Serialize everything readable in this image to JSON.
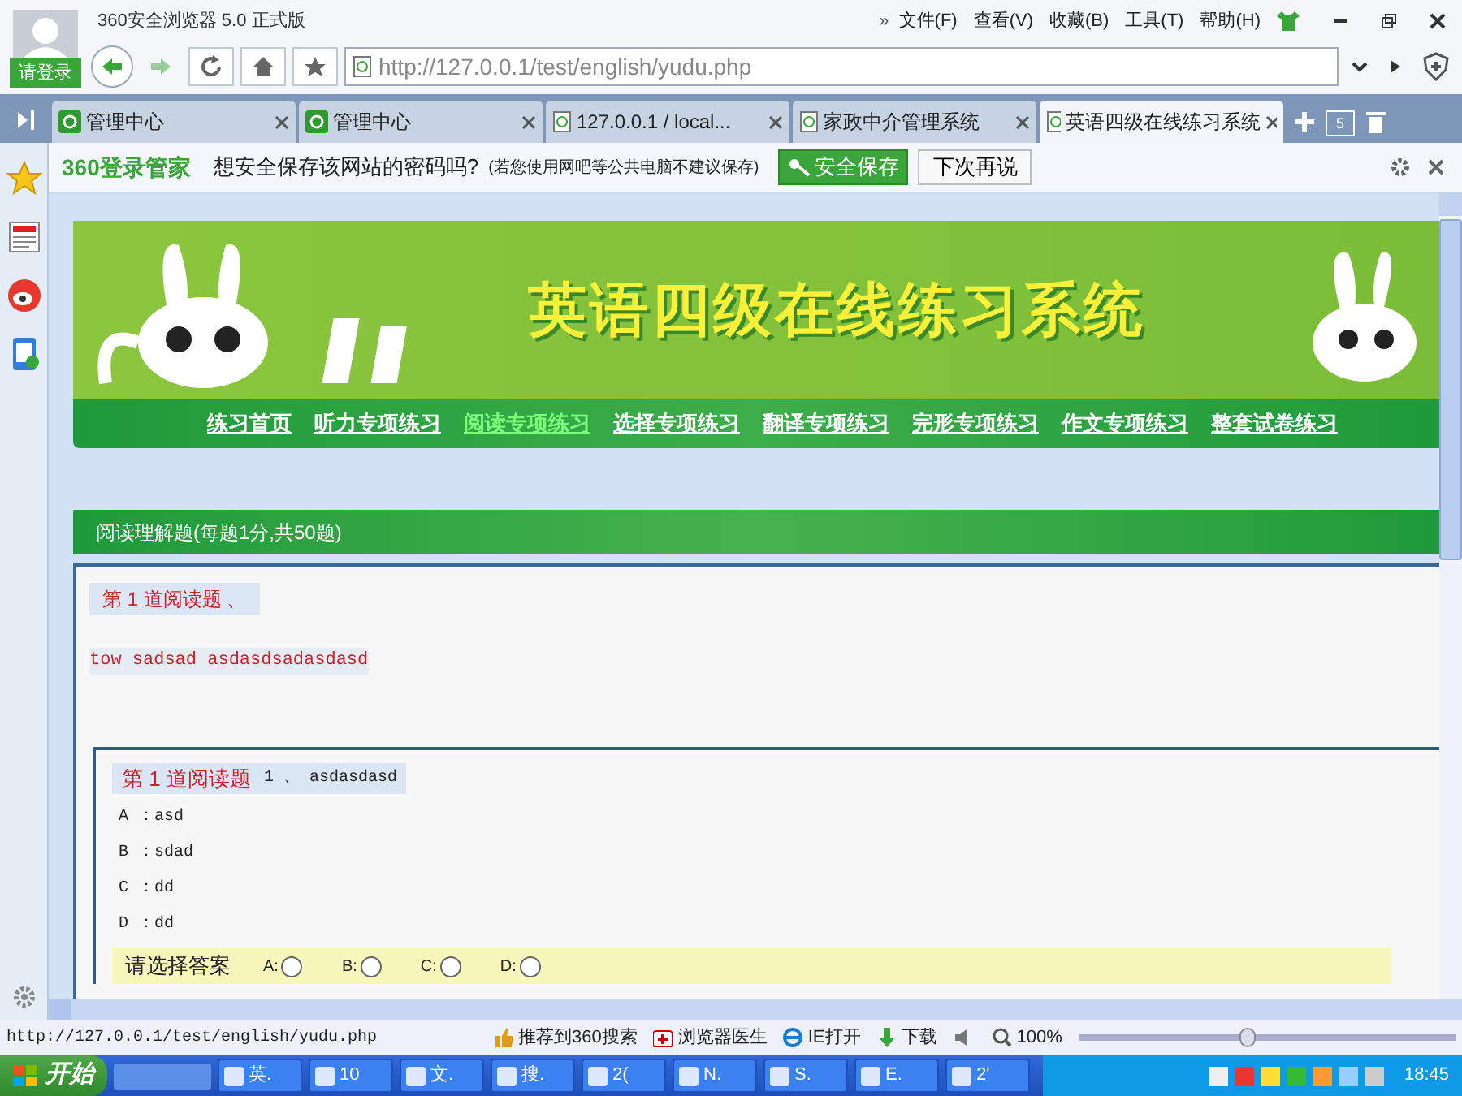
{
  "window": {
    "title": "360安全浏览器 5.0 正式版",
    "login": "请登录",
    "more": "»",
    "menu": [
      "文件(F)",
      "查看(V)",
      "收藏(B)",
      "工具(T)",
      "帮助(H)"
    ]
  },
  "address_bar": {
    "url": "http://127.0.0.1/test/english/yudu.php"
  },
  "tabs": [
    {
      "label": "管理中心",
      "kind": "logo",
      "selected": false
    },
    {
      "label": "管理中心",
      "kind": "logo",
      "selected": false
    },
    {
      "label": "127.0.0.1 / local...",
      "kind": "page",
      "selected": false
    },
    {
      "label": "家政中介管理系统",
      "kind": "page",
      "selected": false
    },
    {
      "label": "英语四级在线练习系统",
      "kind": "page",
      "selected": true
    }
  ],
  "tab_count": "5",
  "password_bar": {
    "brand": "360登录管家",
    "question": "想安全保存该网站的密码吗?",
    "note": "(若您使用网吧等公共电脑不建议保存)",
    "save": "安全保存",
    "later": "下次再说"
  },
  "banner": {
    "title": "英语四级在线练习系统"
  },
  "nav": [
    {
      "label": "练习首页",
      "selected": false
    },
    {
      "label": "听力专项练习",
      "selected": false
    },
    {
      "label": "阅读专项练习",
      "selected": true
    },
    {
      "label": "选择专项练习",
      "selected": false
    },
    {
      "label": "翻译专项练习",
      "selected": false
    },
    {
      "label": "完形专项练习",
      "selected": false
    },
    {
      "label": "作文专项练习",
      "selected": false
    },
    {
      "label": "整套试卷练习",
      "selected": false
    }
  ],
  "section": {
    "title": "阅读理解题(每题1分,共50题)"
  },
  "passage": {
    "heading": "第 1 道阅读题 、",
    "text": "tow sadsad asdasdsadasdasd"
  },
  "question": {
    "heading": "第 1 道阅读题",
    "text": "1 、 asdasdasd",
    "options": [
      "A ：asd",
      "B ：sdad",
      "C ：dd",
      "D ：dd"
    ],
    "answer_label": "请选择答案",
    "choices": [
      {
        "label": "A:",
        "selected": false
      },
      {
        "label": "B:",
        "selected": false
      },
      {
        "label": "C:",
        "selected": false
      },
      {
        "label": "D:",
        "selected": false
      }
    ]
  },
  "status_bar": {
    "url": "http://127.0.0.1/test/english/yudu.php",
    "recommend": "推荐到360搜索",
    "doctor": "浏览器医生",
    "ie": "IE打开",
    "download": "下载",
    "zoom": "100%",
    "zoom_slider": {
      "level": 0.45
    }
  },
  "taskbar": {
    "start": "开始",
    "items": [
      "英.",
      "10",
      "文.",
      "搜.",
      "2(",
      "N.",
      "S.",
      "E.",
      "2'"
    ],
    "clock": "18:45"
  }
}
